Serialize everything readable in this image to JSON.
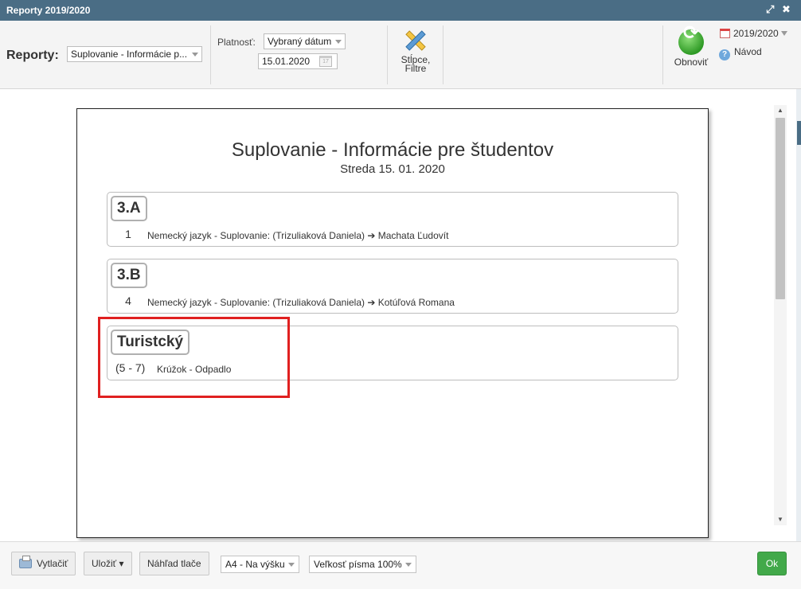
{
  "window": {
    "title": "Reporty 2019/2020",
    "expand_icon": "⤢",
    "close_icon": "✖"
  },
  "toolbar": {
    "reports_label": "Reporty:",
    "report_select": "Suplovanie - Informácie p...",
    "validity_label": "Platnosť:",
    "validity_select": "Vybraný dátum",
    "date_value": "15.01.2020",
    "columns_filter_line1": "Stĺpce,",
    "columns_filter_line2": "Filtre",
    "refresh_label": "Obnoviť",
    "school_year": "2019/2020",
    "help_label": "Návod"
  },
  "report": {
    "title": "Suplovanie - Informácie pre študentov",
    "subtitle": "Streda 15. 01. 2020",
    "groups": [
      {
        "name": "3.A",
        "lesson": "1",
        "text": "Nemecký jazyk - Suplovanie: (Trizuliaková Daniela) ➔ Machata Ľudovít"
      },
      {
        "name": "3.B",
        "lesson": "4",
        "text": "Nemecký jazyk - Suplovanie: (Trizuliaková Daniela) ➔ Kotúľová Romana"
      },
      {
        "name": "Turistcký",
        "lesson": "(5 - 7)",
        "text": "Krúžok - Odpadlo"
      }
    ]
  },
  "footer": {
    "print_label": "Vytlačiť",
    "save_label": "Uložiť ▾",
    "preview_label": "Náhľad tlače",
    "paper_select": "A4 - Na výšku",
    "font_size_select": "Veľkosť písma 100%",
    "ok_label": "Ok"
  },
  "colors": {
    "titlebar": "#4a6d85",
    "ok_button": "#42a94a",
    "highlight": "#e02020"
  }
}
